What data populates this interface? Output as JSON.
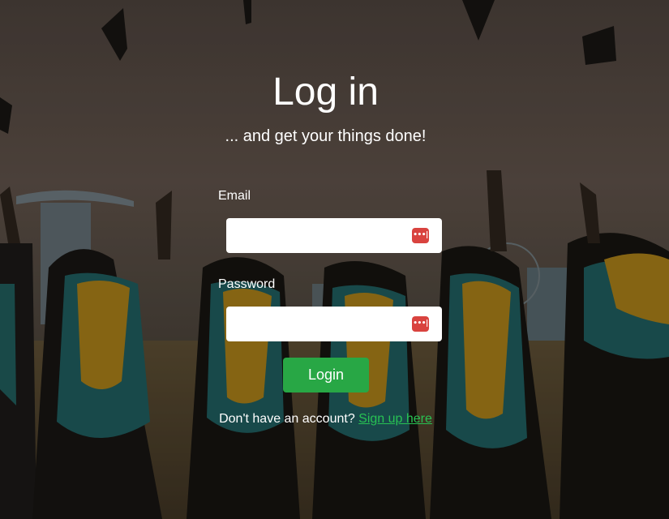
{
  "page": {
    "title": "Log in",
    "subtitle": "... and get your things done!"
  },
  "form": {
    "email_label": "Email",
    "email_value": "",
    "password_label": "Password",
    "password_value": "",
    "password_manager_icon": "password-manager-icon",
    "login_button": "Login"
  },
  "footer": {
    "prompt": "Don't have an account?",
    "signup_link": "Sign up here"
  },
  "colors": {
    "button": "#28a745",
    "link": "#28c253",
    "password_manager_icon": "#d9433f"
  }
}
